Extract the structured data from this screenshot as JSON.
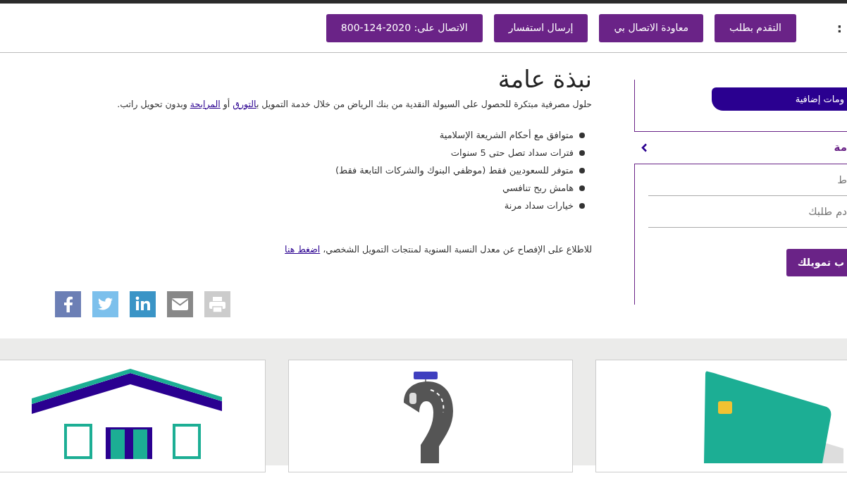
{
  "header": {
    "edge_label": ":",
    "buttons": [
      {
        "label": "التقدم بطلب"
      },
      {
        "label": "معاودة الاتصال بي"
      },
      {
        "label": "إرسال استفسار"
      },
      {
        "label": "الاتصال على: 2020-124-800"
      }
    ]
  },
  "sidebar": {
    "info_button": "ومات إضافية",
    "accordion_label": "مة",
    "links": [
      "ط",
      "دم طلبك"
    ],
    "action_button": "ب تمويلك"
  },
  "overview": {
    "title": "نبذة عامة",
    "intro": {
      "before": "حلول مصرفية مبتكرة للحصول على السيولة النقدية من بنك الرياض من خلال خدمة التمويل ب",
      "link_1": "التورق",
      "middle": " أو ",
      "link_2": "المرابحة",
      "after": " وبدون تحويل راتب."
    },
    "features": [
      "متوافق مع أحكام الشريعة الإسلامية",
      "فترات سداد تصل حتى 5 سنوات",
      "متوفر للسعوديين فقط (موظفي البنوك والشركات التابعة فقط)",
      "هامش ربح تنافسي",
      "خيارات سداد مرنة"
    ],
    "disclosure": {
      "text": "للاطلاع على الإفصاح عن معدل النسبة السنوية لمنتجات التمويل الشخصي، ",
      "link": "اضغط هنا"
    }
  }
}
